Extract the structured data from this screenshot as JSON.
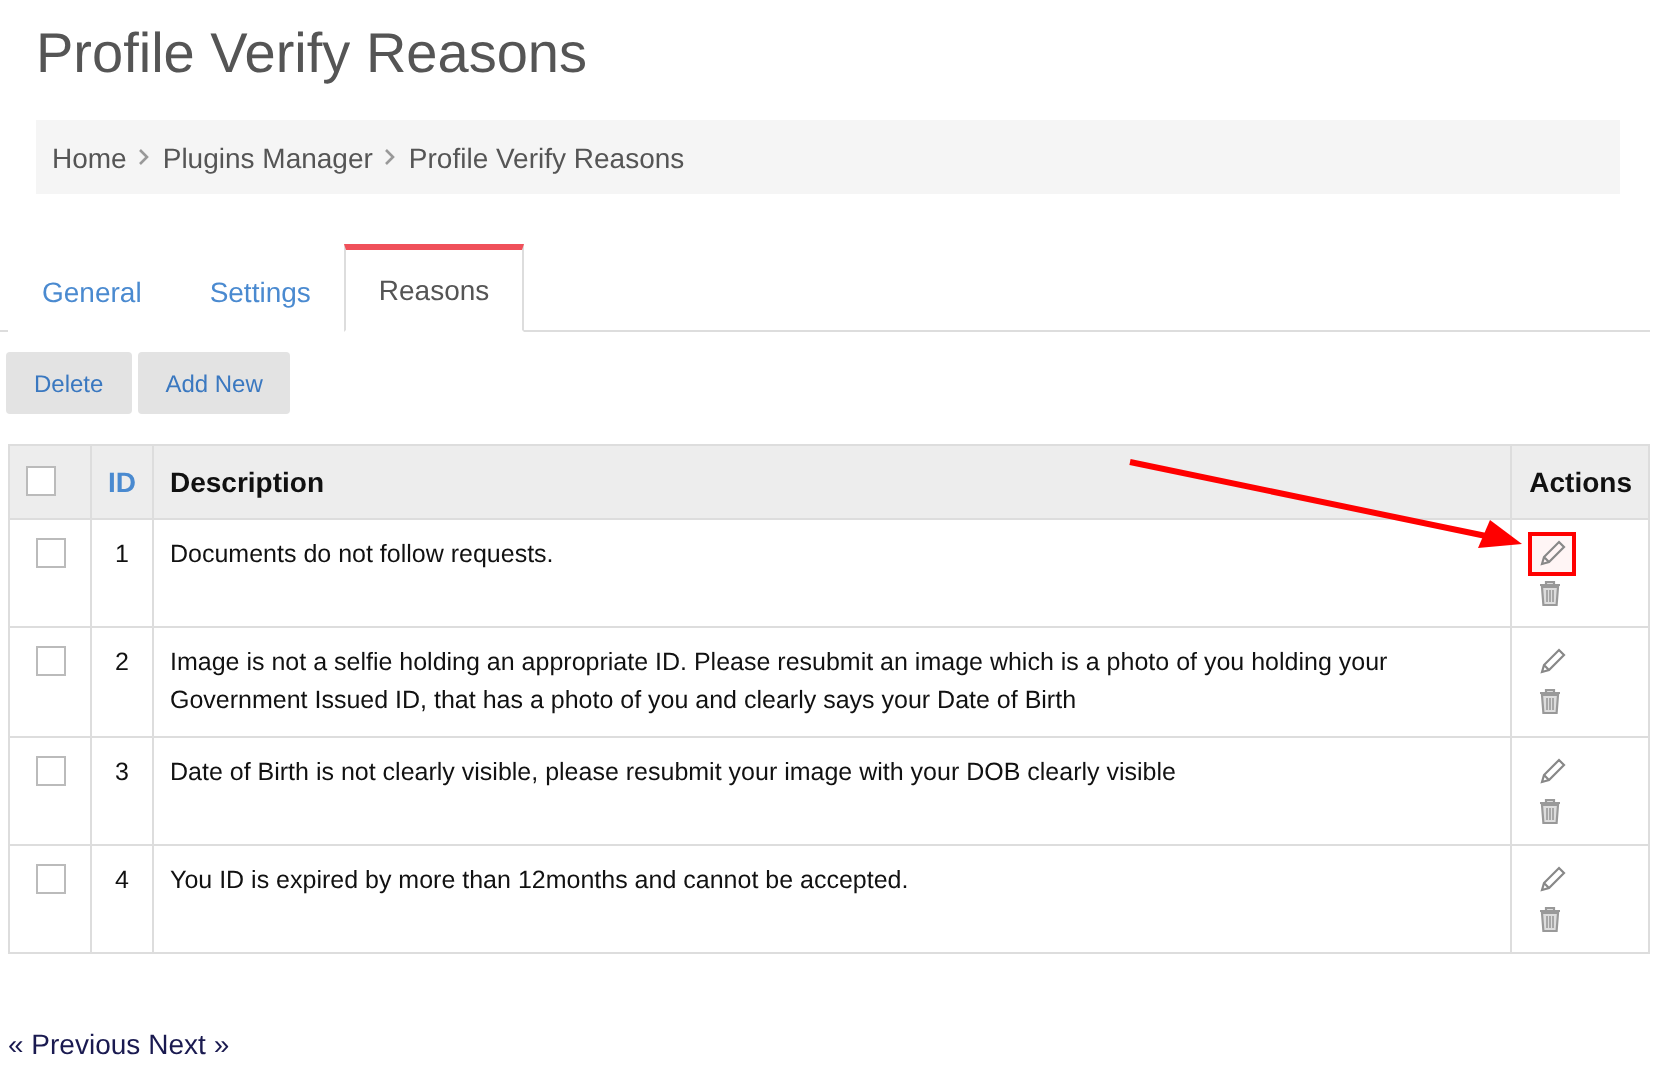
{
  "page_title": "Profile Verify Reasons",
  "breadcrumb": [
    "Home",
    "Plugins Manager",
    "Profile Verify Reasons"
  ],
  "tabs": [
    {
      "label": "General",
      "selected": false
    },
    {
      "label": "Settings",
      "selected": false
    },
    {
      "label": "Reasons",
      "selected": true
    }
  ],
  "buttons": [
    "Delete",
    "Add New"
  ],
  "table": {
    "select_all_checked": false,
    "columns": [
      "ID",
      "Description",
      "Actions"
    ],
    "rows": [
      {
        "checked": false,
        "id": "1",
        "description": "Documents do not follow requests.",
        "highlighted": true
      },
      {
        "checked": false,
        "id": "2",
        "description": "Image is not a selfie holding an appropriate ID. Please resubmit an image which is a photo of you holding your Government Issued ID, that has a photo of you and clearly says your Date of Birth",
        "highlighted": false
      },
      {
        "checked": false,
        "id": "3",
        "description": "Date of Birth is not clearly visible, please resubmit your image with your DOB clearly visible",
        "highlighted": false
      },
      {
        "checked": false,
        "id": "4",
        "description": "You ID is expired by more than 12months and cannot be accepted.",
        "highlighted": false
      }
    ]
  },
  "pagination": [
    "« Previous",
    "Next »"
  ]
}
